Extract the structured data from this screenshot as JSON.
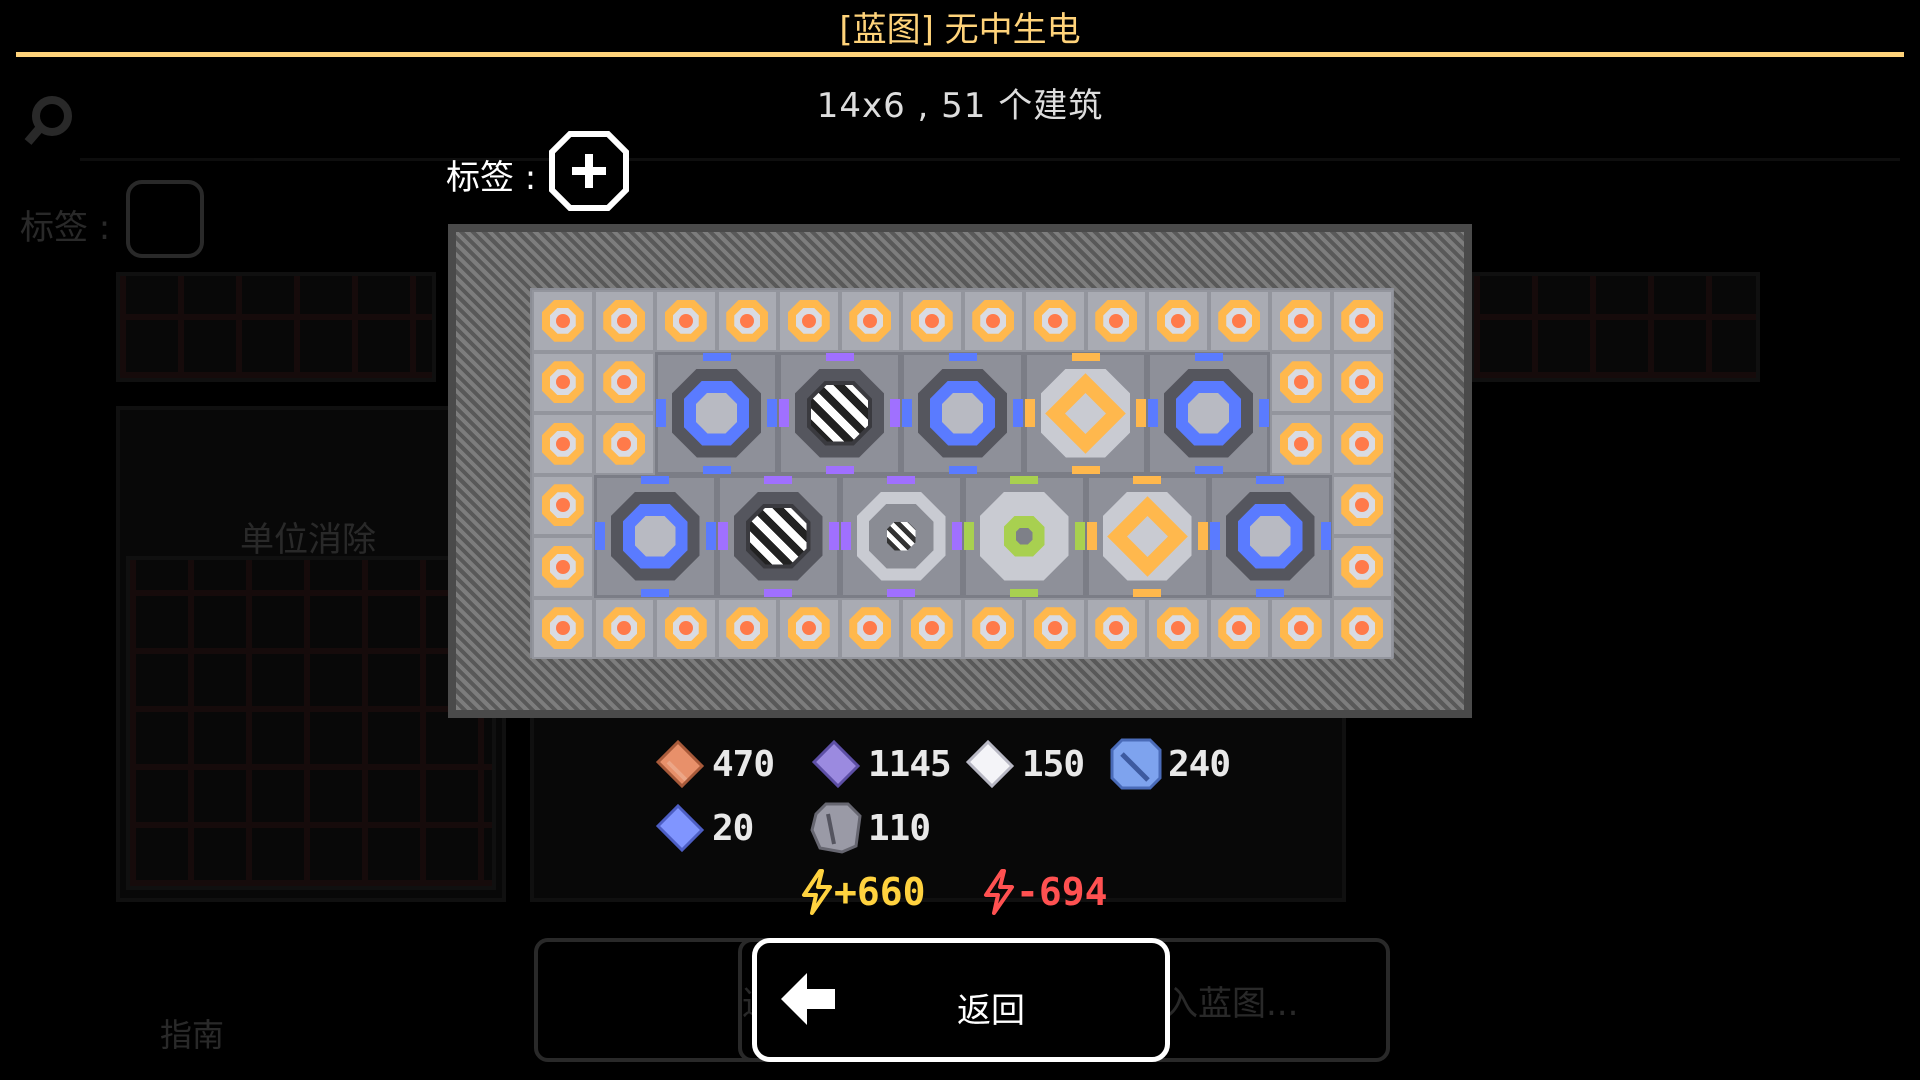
{
  "header": {
    "title": "[蓝图] 无中生电",
    "summary": "14x6 , 51 个建筑"
  },
  "tags": {
    "label": "标签 :"
  },
  "background": {
    "tag_label": "标签 :",
    "card_title": "单位消除",
    "bottom_left_label": "指南",
    "bottom_mid_label": "返",
    "bottom_right_label": "入蓝图..."
  },
  "requirements": [
    {
      "name": "copper",
      "value": "470",
      "color": "#e8906a"
    },
    {
      "name": "silicon",
      "value": "1145",
      "color": "#9b8ae0"
    },
    {
      "name": "metaglass",
      "value": "150",
      "color": "#f4f4f8"
    },
    {
      "name": "titanium",
      "value": "240",
      "color": "#7ea3ee"
    },
    {
      "name": "plastanium",
      "value": "20",
      "color": "#8095ff"
    },
    {
      "name": "lead",
      "value": "110",
      "color": "#9a9aa6"
    }
  ],
  "power": {
    "produced": "+660",
    "consumed": "-694",
    "produced_color": "#ffd23f",
    "consumed_color": "#ff5151"
  },
  "buttons": {
    "back_label": "返回"
  },
  "icons": {
    "search": "search-icon",
    "tag_add": "plus-icon",
    "back": "arrow-left-icon",
    "power_plus": "lightning-icon",
    "power_minus": "lightning-outline-icon"
  }
}
